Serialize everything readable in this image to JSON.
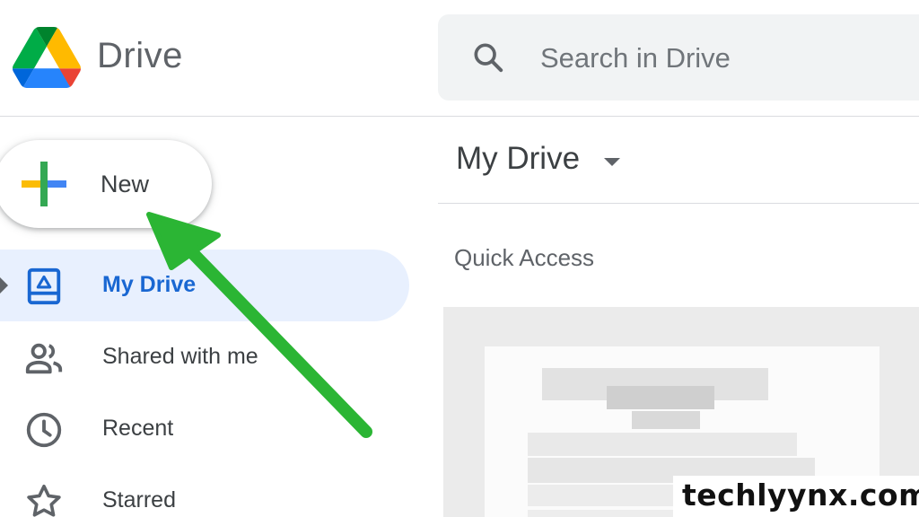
{
  "app": {
    "name": "Drive",
    "logo_icon": "google-drive-logo-icon"
  },
  "search": {
    "placeholder": "Search in Drive",
    "icon": "search-icon"
  },
  "new_button": {
    "label": "New",
    "icon": "plus-icon"
  },
  "sidebar": {
    "items": [
      {
        "label": "My Drive",
        "icon": "my-drive-icon",
        "active": true
      },
      {
        "label": "Shared with me",
        "icon": "people-icon",
        "active": false
      },
      {
        "label": "Recent",
        "icon": "clock-icon",
        "active": false
      },
      {
        "label": "Starred",
        "icon": "star-icon",
        "active": false
      }
    ]
  },
  "main": {
    "title": "My Drive",
    "section": "Quick Access"
  },
  "watermark": "techlyynx.com",
  "colors": {
    "accent": "#1967d2",
    "active_bg": "#e8f0fe",
    "arrow": "#2bb534",
    "drive_yellow": "#fbbc04",
    "drive_green": "#34a853",
    "drive_blue": "#4285f4"
  }
}
